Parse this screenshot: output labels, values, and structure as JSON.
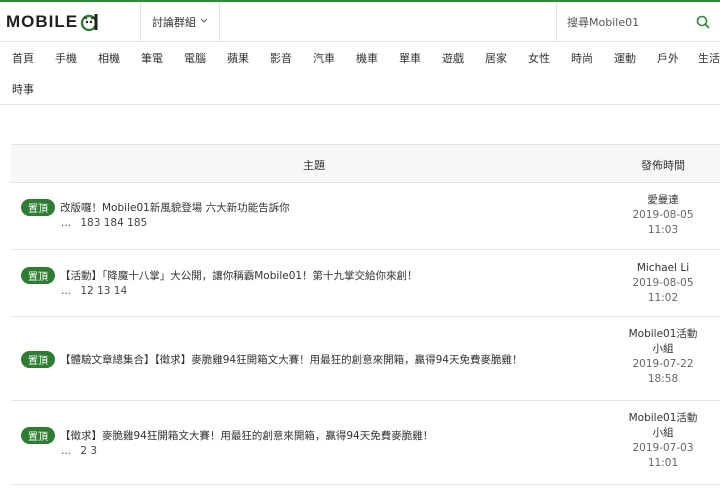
{
  "header": {
    "logo_text": "MOBILE",
    "forum_menu_label": "討論群組",
    "search_placeholder": "搜尋Mobile01"
  },
  "colors": {
    "brand_green": "#2e7d32",
    "pin_badge": "#2e7d32"
  },
  "nav": {
    "items": [
      "首頁",
      "手機",
      "相機",
      "筆電",
      "電腦",
      "蘋果",
      "影音",
      "汽車",
      "機車",
      "單車",
      "遊戲",
      "居家",
      "女性",
      "時尚",
      "運動",
      "戶外",
      "生活",
      "時事"
    ]
  },
  "table": {
    "header_topic": "主題",
    "header_date": "發佈時間",
    "rows": [
      {
        "badge": "置頂",
        "title": "改版囉！Mobile01新風貌登場 六大新功能告訴你",
        "pages": [
          "...",
          "183",
          "184",
          "185"
        ],
        "author": "愛曼達",
        "date": "2019-08-05",
        "time": "11:03"
      },
      {
        "badge": "置頂",
        "title": "【活動】「降魔十八掌」大公開，讓你稱霸Mobile01！第十九掌交給你來創！",
        "pages": [
          "...",
          "12",
          "13",
          "14"
        ],
        "author": "Michael Li",
        "date": "2019-08-05",
        "time": "11:02"
      },
      {
        "badge": "置頂",
        "title": "【體驗文章總集合】【徵求】麥脆雞94狂開箱文大賽！用最狂的創意來開箱，贏得94天免費麥脆雞！",
        "pages": [],
        "author_line1": "Mobile01活動",
        "author_line2": "小組",
        "date": "2019-07-22",
        "time": "18:58"
      },
      {
        "badge": "置頂",
        "title": "【徵求】麥脆雞94狂開箱文大賽！用最狂的創意來開箱，贏得94天免費麥脆雞！",
        "pages": [
          "...",
          "2",
          "3"
        ],
        "author_line1": "Mobile01活動",
        "author_line2": "小組",
        "date": "2019-07-03",
        "time": "11:01"
      }
    ]
  }
}
